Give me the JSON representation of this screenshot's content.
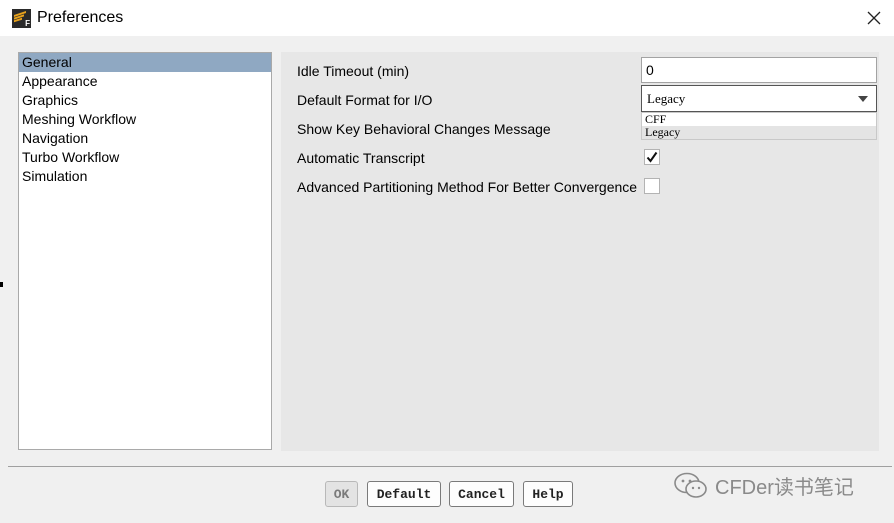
{
  "window": {
    "title": "Preferences",
    "app_icon_letter": "F"
  },
  "nav": {
    "selected_index": 0,
    "items": [
      {
        "label": "General"
      },
      {
        "label": "Appearance"
      },
      {
        "label": "Graphics"
      },
      {
        "label": "Meshing Workflow"
      },
      {
        "label": "Navigation"
      },
      {
        "label": "Turbo Workflow"
      },
      {
        "label": "Simulation"
      }
    ]
  },
  "general": {
    "idle_timeout_label": "Idle Timeout (min)",
    "idle_timeout_value": "0",
    "default_format_label": "Default Format for I/O",
    "default_format_value": "Legacy",
    "default_format_options": [
      "CFF",
      "Legacy"
    ],
    "show_key_label": "Show Key Behavioral Changes Message",
    "auto_transcript_label": "Automatic Transcript",
    "auto_transcript_checked": true,
    "adv_partition_label": "Advanced Partitioning Method For Better Convergence",
    "adv_partition_checked": false
  },
  "buttons": {
    "ok": "OK",
    "default": "Default",
    "cancel": "Cancel",
    "help": "Help"
  },
  "watermark": {
    "text": "CFDer读书笔记"
  },
  "colors": {
    "selection": "#8fa8c2",
    "panel_bg": "#e7e7e7",
    "window_bg": "#f0f0f0"
  }
}
